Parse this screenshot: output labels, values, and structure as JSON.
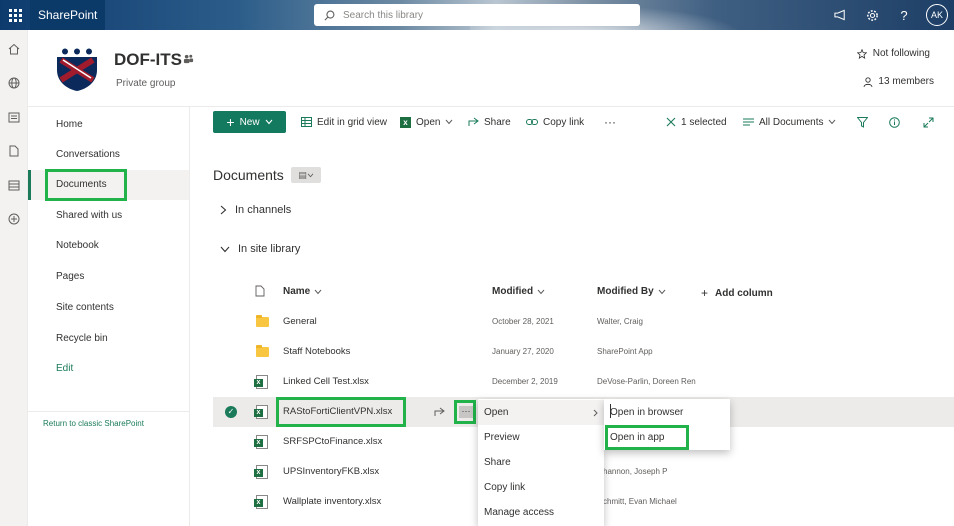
{
  "app": {
    "name": "SharePoint",
    "search_placeholder": "Search this library",
    "avatar_initials": "AK"
  },
  "site": {
    "title": "DOF-ITS",
    "subtitle": "Private group",
    "follow_label": "Not following",
    "members_label": "13 members"
  },
  "nav": {
    "items": [
      "Home",
      "Conversations",
      "Documents",
      "Shared with us",
      "Notebook",
      "Pages",
      "Site contents",
      "Recycle bin"
    ],
    "edit_label": "Edit",
    "classic_link": "Return to classic SharePoint"
  },
  "toolbar": {
    "new_label": "New",
    "edit_grid_label": "Edit in grid view",
    "open_label": "Open",
    "share_label": "Share",
    "copy_link_label": "Copy link",
    "more_label": "···",
    "selected_label": "1 selected",
    "view_label": "All Documents"
  },
  "library": {
    "title": "Documents",
    "groups": [
      "In channels",
      "In site library"
    ],
    "columns": {
      "name": "Name",
      "modified": "Modified",
      "modified_by": "Modified By",
      "add_column": "Add column"
    },
    "rows": [
      {
        "type": "folder",
        "name": "General",
        "modified": "October 28, 2021",
        "modified_by": "Walter, Craig"
      },
      {
        "type": "folder",
        "name": "Staff Notebooks",
        "modified": "January 27, 2020",
        "modified_by": "SharePoint App"
      },
      {
        "type": "excel",
        "name": "Linked Cell Test.xlsx",
        "modified": "December 2, 2019",
        "modified_by": "DeVose-Parlin, Doreen Ren"
      },
      {
        "type": "excel",
        "name": "RAStoFortiClientVPN.xlsx",
        "modified": "",
        "modified_by": ""
      },
      {
        "type": "excel",
        "name": "SRFSPCtoFinance.xlsx",
        "modified": "",
        "modified_by": ""
      },
      {
        "type": "excel",
        "name": "UPSInventoryFKB.xlsx",
        "modified": "",
        "modified_by": "hannon, Joseph P"
      },
      {
        "type": "excel",
        "name": "Wallplate inventory.xlsx",
        "modified": "",
        "modified_by": "chmitt, Evan Michael"
      }
    ]
  },
  "context_menu": {
    "items": [
      "Open",
      "Preview",
      "Share",
      "Copy link",
      "Manage access"
    ]
  },
  "submenu": {
    "items": [
      "Open in browser",
      "Open in app"
    ]
  },
  "colors": {
    "accent": "#137a5f",
    "highlight_box": "#21b34a",
    "suite_bar": "#0b3a69"
  }
}
